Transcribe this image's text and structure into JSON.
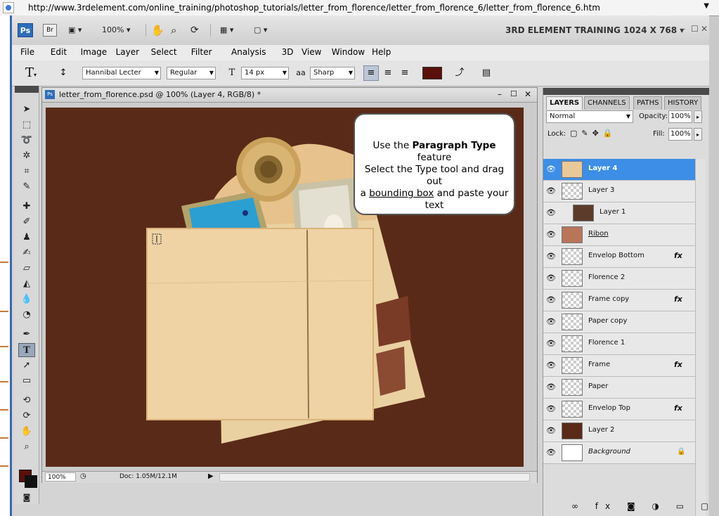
{
  "browser": {
    "url": "http://www.3rdelement.com/online_training/photoshop_tutorials/letter_from_florence/letter_from_florence_6/letter_from_florence_6.htm"
  },
  "appbar": {
    "ps_label": "Ps",
    "br_label": "Br",
    "zoom": "100%",
    "workspace": "3RD ELEMENT TRAINING 1024 X 768"
  },
  "menu": [
    "File",
    "Edit",
    "Image",
    "Layer",
    "Select",
    "Filter",
    "Analysis",
    "3D",
    "View",
    "Window",
    "Help"
  ],
  "options": {
    "tool_glyph": "T",
    "font_family": "Hannibal Lecter",
    "font_style": "Regular",
    "font_size": "14 px",
    "aa_label": "a",
    "antialias": "Sharp",
    "text_color": "#5b0f0b"
  },
  "document": {
    "title": "letter_from_florence.psd @ 100% (Layer 4, RGB/8) *",
    "status_zoom": "100%",
    "doc_size": "Doc: 1.05M/12.1M",
    "canvas_color": "#5a2a18"
  },
  "callout": {
    "line1_prefix": "Use the ",
    "line1_bold": "Paragraph Type",
    "line1_suffix": " feature",
    "line2": "Select the Type tool and drag out",
    "line3_prefix": "a ",
    "line3_link": "bounding box",
    "line3_suffix": " and paste your",
    "line4": "text"
  },
  "layers_panel": {
    "tabs": [
      "LAYERS",
      "CHANNELS",
      "PATHS",
      "HISTORY"
    ],
    "blend_mode": "Normal",
    "opacity_label": "Opacity:",
    "opacity": "100%",
    "lock_label": "Lock:",
    "fill_label": "Fill:",
    "fill": "100%",
    "layers": [
      {
        "name": "Layer 4",
        "selected": true,
        "fx": false
      },
      {
        "name": "Layer 3",
        "selected": false,
        "fx": false
      },
      {
        "name": "Layer 1",
        "selected": false,
        "fx": false
      },
      {
        "name": "Ribon",
        "selected": false,
        "fx": false
      },
      {
        "name": "Envelop Bottom",
        "selected": false,
        "fx": true
      },
      {
        "name": "Florence 2",
        "selected": false,
        "fx": false
      },
      {
        "name": "Frame copy",
        "selected": false,
        "fx": true
      },
      {
        "name": "Paper copy",
        "selected": false,
        "fx": false
      },
      {
        "name": "Florence 1",
        "selected": false,
        "fx": false
      },
      {
        "name": "Frame",
        "selected": false,
        "fx": true
      },
      {
        "name": "Paper",
        "selected": false,
        "fx": false
      },
      {
        "name": "Envelop Top",
        "selected": false,
        "fx": true
      },
      {
        "name": "Layer 2",
        "selected": false,
        "fx": false
      },
      {
        "name": "Background",
        "selected": false,
        "fx": false
      }
    ],
    "fx_label": "fx"
  },
  "colors": {
    "foreground": "#5b0f0b",
    "background": "#111111",
    "selection": "#3d8ee6"
  }
}
